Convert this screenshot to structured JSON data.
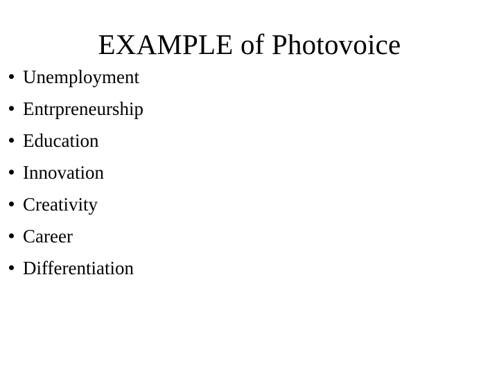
{
  "slide": {
    "title": "EXAMPLE of Photovoice",
    "background_color": "#ffffff",
    "text_color": "#000000",
    "bullet_glyph": "bullet-dot",
    "bullets": [
      {
        "label": "Unemployment"
      },
      {
        "label": "Entrpreneurship"
      },
      {
        "label": "Education"
      },
      {
        "label": "Innovation"
      },
      {
        "label": "Creativity"
      },
      {
        "label": "Career"
      },
      {
        "label": "Differentiation"
      }
    ]
  }
}
